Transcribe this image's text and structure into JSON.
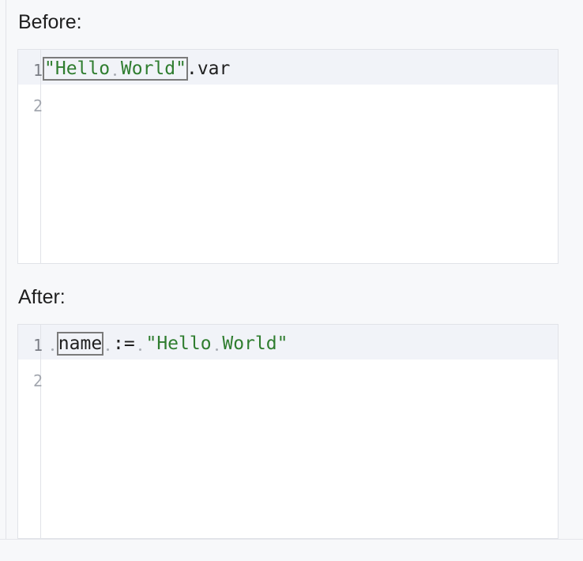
{
  "before": {
    "label": "Before:",
    "line_numbers": [
      "1",
      "2"
    ],
    "code": {
      "string_open": "\"Hello",
      "string_close": "World\"",
      "suffix": ".var"
    }
  },
  "after": {
    "label": "After:",
    "line_numbers": [
      "1",
      "2"
    ],
    "code": {
      "identifier": "name",
      "operator": ":=",
      "string_open": "\"Hello",
      "string_close": "World\""
    }
  },
  "colors": {
    "string": "#2f7d2f",
    "text": "#1f1f1f",
    "current_line": "#f1f3f8",
    "template_box": "#7b7b7b"
  }
}
